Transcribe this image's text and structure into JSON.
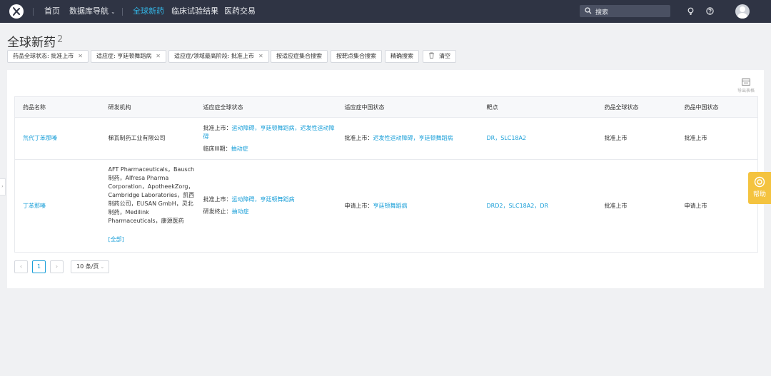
{
  "nav": {
    "items": [
      "首页",
      "数据库导航",
      "全球新药",
      "临床试验结果",
      "医药交易"
    ],
    "active_index": 2,
    "search_placeholder": "搜索"
  },
  "page": {
    "title": "全球新药",
    "count": "2"
  },
  "filters": [
    {
      "label": "药品全球状态: 批准上市",
      "removable": true
    },
    {
      "label": "适应症: 亨廷顿舞蹈病",
      "removable": true
    },
    {
      "label": "适应症/领域最高阶段: 批准上市",
      "removable": true
    },
    {
      "label": "按适应症集合搜索",
      "removable": false
    },
    {
      "label": "按靶点集合搜索",
      "removable": false
    },
    {
      "label": "精确搜索",
      "removable": false
    },
    {
      "label": "清空",
      "removable": false
    }
  ],
  "export_label": "导出表格",
  "table": {
    "headers": [
      "药品名称",
      "研发机构",
      "适应症全球状态",
      "适应症中国状态",
      "靶点",
      "药品全球状态",
      "药品中国状态"
    ],
    "rows": [
      {
        "name": "氘代丁苯那嗪",
        "org": "梯瓦制药工业有限公司",
        "global_groups": [
          {
            "status": "批准上市：",
            "inds": "运动障碍，亨廷顿舞蹈病，迟发性运动障碍"
          },
          {
            "status": "临床III期：",
            "inds": "抽动症"
          }
        ],
        "china_groups": [
          {
            "status": "批准上市：",
            "inds": "迟发性运动障碍，亨廷顿舞蹈病"
          }
        ],
        "targets": "DR，SLC18A2",
        "global_status": "批准上市",
        "china_status": "批准上市"
      },
      {
        "name": "丁苯那嗪",
        "org": "AFT Pharmaceuticals，Bausch制药，Alfresa Pharma Corporation，ApotheekZorg，Cambridge Laboratories，凯西制药公司，EUSAN GmbH，灵北制药，Medilink Pharmaceuticals，康源医药",
        "org_more": "[全部]",
        "global_groups": [
          {
            "status": "批准上市：",
            "inds": "运动障碍，亨廷顿舞蹈病"
          },
          {
            "status": "研发终止：",
            "inds": "抽动症"
          }
        ],
        "china_groups": [
          {
            "status": "申请上市：",
            "inds": "亨廷顿舞蹈病"
          }
        ],
        "targets": "DRD2，SLC18A2，DR",
        "global_status": "批准上市",
        "china_status": "申请上市"
      }
    ]
  },
  "pagination": {
    "prev": "‹",
    "current": "1",
    "next": "›",
    "page_size": "10 条/页"
  },
  "help_label": "帮助",
  "side_toggle": "›",
  "colors": {
    "topbar": "#2f3444",
    "accent": "#33b5e5",
    "link": "#1a9fd8",
    "help": "#f4c33f"
  }
}
